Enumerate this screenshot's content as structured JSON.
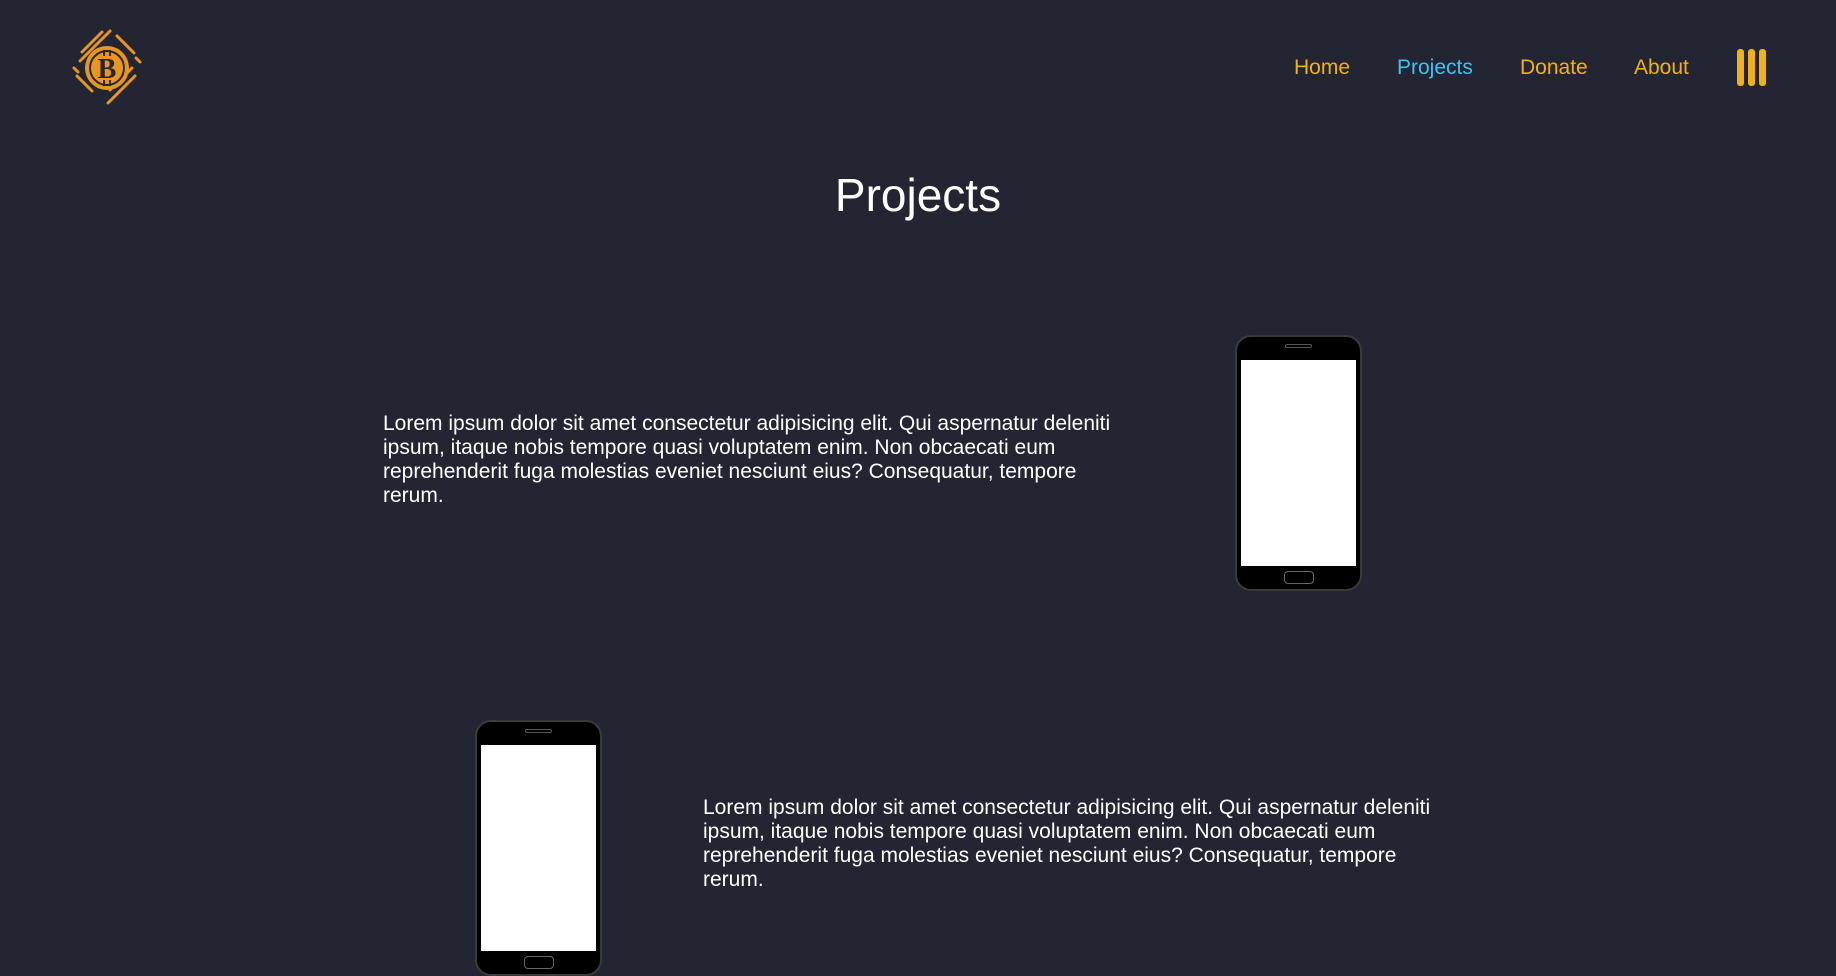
{
  "header": {
    "logo_icon": "bitcoin-logo-icon",
    "nav": [
      {
        "label": "Home",
        "active": false
      },
      {
        "label": "Projects",
        "active": true
      },
      {
        "label": "Donate",
        "active": false
      },
      {
        "label": "About",
        "active": false
      }
    ],
    "menu_icon": "menu-bars-icon"
  },
  "main": {
    "title": "Projects",
    "projects": [
      {
        "description": "Lorem ipsum dolor sit amet consectetur adipisicing elit. Qui aspernatur deleniti ipsum, itaque nobis tempore quasi voluptatem enim. Non obcaecati eum reprehenderit fuga molestias eveniet nesciunt eius? Consequatur, tempore rerum.",
        "image_icon": "smartphone-icon"
      },
      {
        "description": "Lorem ipsum dolor sit amet consectetur adipisicing elit. Qui aspernatur deleniti ipsum, itaque nobis tempore quasi voluptatem enim. Non obcaecati eum reprehenderit fuga molestias eveniet nesciunt eius? Consequatur, tempore rerum.",
        "image_icon": "smartphone-icon"
      }
    ]
  },
  "colors": {
    "background": "#232533",
    "accent": "#f2b114",
    "active_link": "#3ec3f0",
    "text": "#ffffff"
  }
}
